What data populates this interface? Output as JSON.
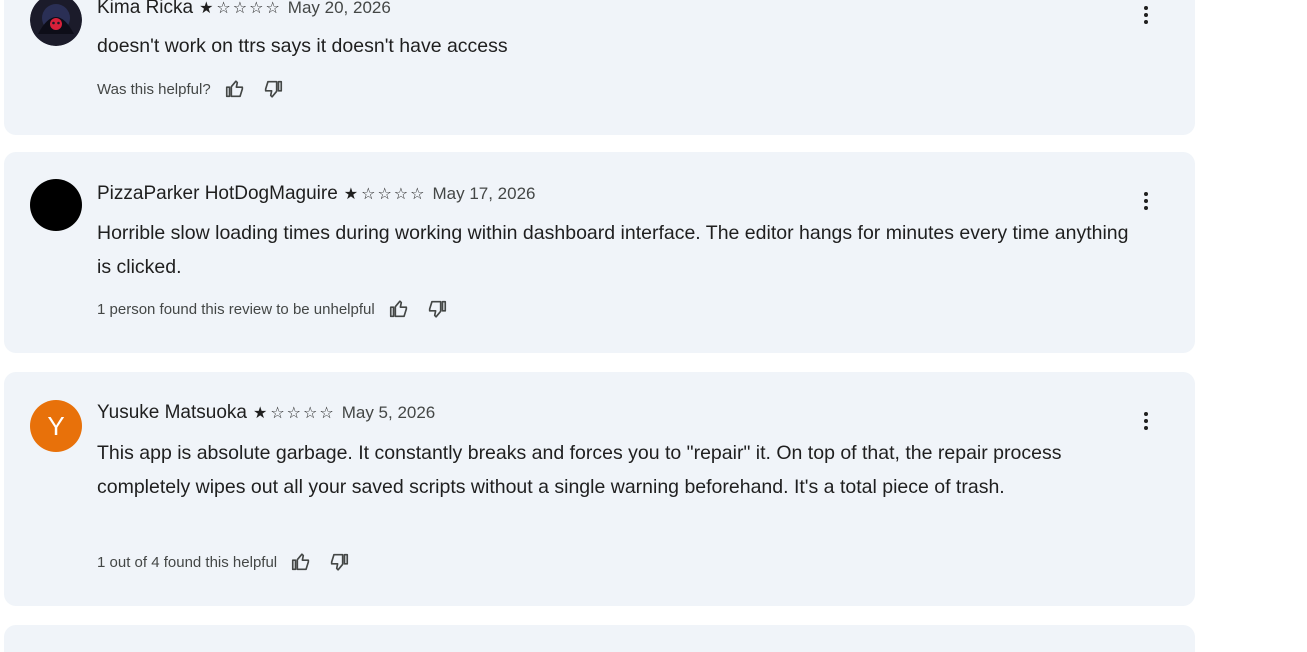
{
  "reviews": [
    {
      "author": "Kima Ricka",
      "stars_full": "★",
      "stars_empty": "☆☆☆☆",
      "rating": 1,
      "date": "May 20, 2026",
      "text": "doesn't work on ttrs says it doesn't have access",
      "helpful_text": "Was this helpful?",
      "avatar_type": "image",
      "avatar_color": "#1b1b2a"
    },
    {
      "author": "PizzaParker HotDogMaguire",
      "stars_full": "★",
      "stars_empty": "☆☆☆☆",
      "rating": 1,
      "date": "May 17, 2026",
      "text": "Horrible slow loading times during working within dashboard interface. The editor hangs for minutes every time anything is clicked.",
      "helpful_text": "1 person found this review to be unhelpful",
      "avatar_type": "solid",
      "avatar_color": "#000000"
    },
    {
      "author": "Yusuke Matsuoka",
      "stars_full": "★",
      "stars_empty": "☆☆☆☆",
      "rating": 1,
      "date": "May 5, 2026",
      "text": "This app is absolute garbage. It constantly breaks and forces you to \"repair\" it. On top of that, the repair process completely wipes out all your saved scripts without a single warning beforehand. It's a total piece of trash.",
      "helpful_text": "1 out of 4 found this helpful",
      "avatar_type": "letter",
      "avatar_letter": "Y",
      "avatar_color": "#e8710a"
    }
  ],
  "icons": {
    "thumb_up": "thumb-up-icon",
    "thumb_down": "thumb-down-icon",
    "more": "more-vert-icon"
  }
}
